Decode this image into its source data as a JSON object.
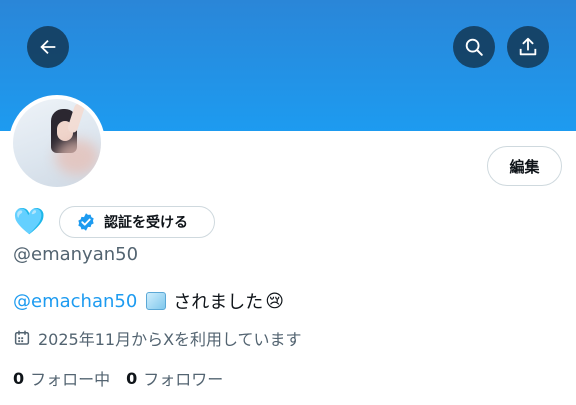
{
  "icons": {
    "back": "arrow-left-icon",
    "search": "search-icon",
    "share": "share-icon",
    "verified": "verified-badge-icon",
    "heart": "blue-heart-icon",
    "calendar": "calendar-icon",
    "ice": "ice-cube-icon",
    "crying": "crying-face-icon"
  },
  "colors": {
    "banner": "#1d9bf0",
    "accent": "#1d9bf0",
    "secondary_text": "#536471"
  },
  "header": {
    "edit_label": "編集"
  },
  "profile": {
    "heart": "🩵",
    "verify_label": "認証を受ける",
    "handle": "@emanyan50",
    "bio_mention": "@emachan50",
    "bio_text": "されました",
    "bio_emoji_end": "😢",
    "joined": "2025年11月からXを利用しています",
    "following_count": "0",
    "following_label": "フォロー中",
    "followers_count": "0",
    "followers_label": "フォロワー"
  }
}
